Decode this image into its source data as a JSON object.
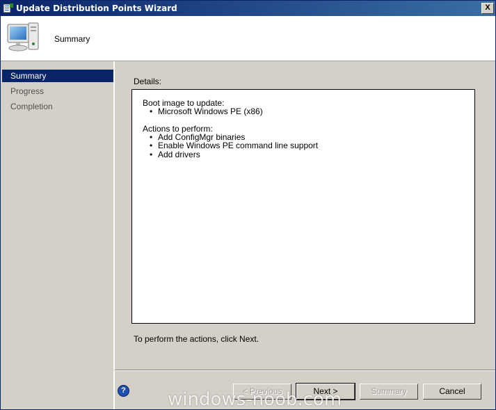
{
  "window": {
    "title": "Update Distribution Points Wizard",
    "close_label": "X"
  },
  "header": {
    "step_title": "Summary"
  },
  "sidebar": {
    "items": [
      {
        "label": "Summary",
        "active": true
      },
      {
        "label": "Progress",
        "active": false
      },
      {
        "label": "Completion",
        "active": false
      }
    ]
  },
  "main": {
    "details_label": "Details:",
    "boot_heading": "Boot image to update:",
    "boot_items": [
      "Microsoft Windows PE (x86)"
    ],
    "actions_heading": "Actions to perform:",
    "action_items": [
      "Add ConfigMgr binaries",
      "Enable Windows PE command line support",
      "Add drivers"
    ],
    "hint": "To perform the actions, click Next."
  },
  "footer": {
    "help_label": "?",
    "previous_label": "< Previous",
    "next_label": "Next >",
    "summary_label": "Summary",
    "cancel_label": "Cancel"
  },
  "watermark": "windows-noob.com"
}
